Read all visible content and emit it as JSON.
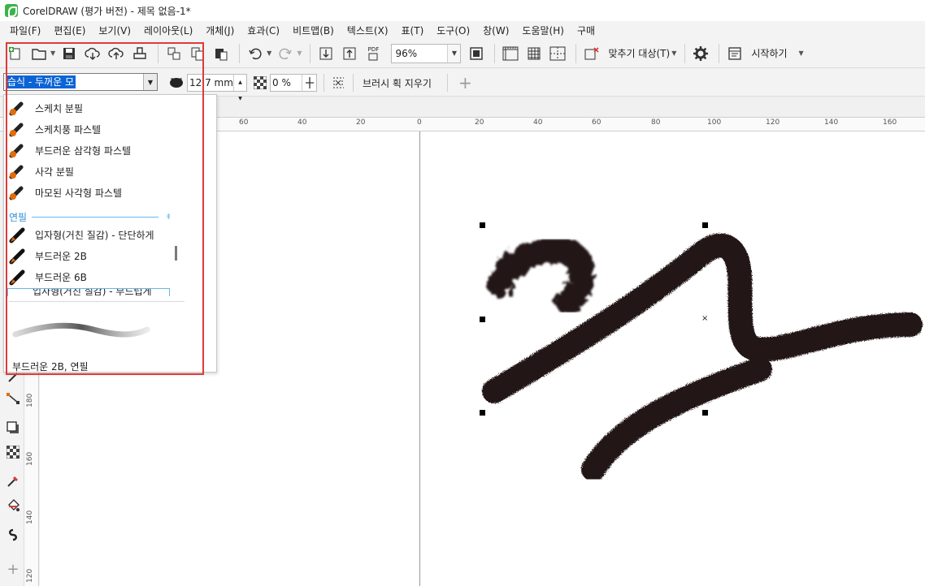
{
  "window": {
    "title": "CorelDRAW (평가 버전) - 제목 없음-1*"
  },
  "menu": [
    "파일(F)",
    "편집(E)",
    "보기(V)",
    "레이아웃(L)",
    "개체(J)",
    "효과(C)",
    "비트맵(B)",
    "텍스트(X)",
    "표(T)",
    "도구(O)",
    "창(W)",
    "도움말(H)",
    "구매"
  ],
  "toolbar": {
    "zoom": "96%",
    "snap_label": "맞추기 대상(T)",
    "welcome_label": "시작하기",
    "pdf_label": "PDF"
  },
  "propbar": {
    "brush_preset": "습식 - 두꺼운 모",
    "size": "12.7 mm",
    "transparency": "0 %",
    "clear_stroke": "브러시 획 지우기"
  },
  "ruler": {
    "h": [
      "60",
      "40",
      "20",
      "0",
      "20",
      "40",
      "60",
      "80",
      "100",
      "120",
      "140",
      "160"
    ],
    "v": [
      "180",
      "160",
      "140",
      "120"
    ]
  },
  "dropdown": {
    "items_top": [
      "스케치 분필",
      "스케치풍 파스텔",
      "부드러운 삼각형 파스텔",
      "사각 분필",
      "마모된 사각형 파스텔"
    ],
    "category": "연필",
    "items_pencil": [
      "입자형(거친 질감) - 단단하게",
      "부드러운 2B",
      "부드러운 6B"
    ],
    "partial_item": "입자형(거친 질감) - 부드럽게",
    "preview_caption": "부드러운 2B, 연필"
  },
  "colors": {
    "accent": "#0a64d6",
    "highlight": "#e03a3a",
    "ink": "#231717",
    "category": "#2f8fd8"
  }
}
